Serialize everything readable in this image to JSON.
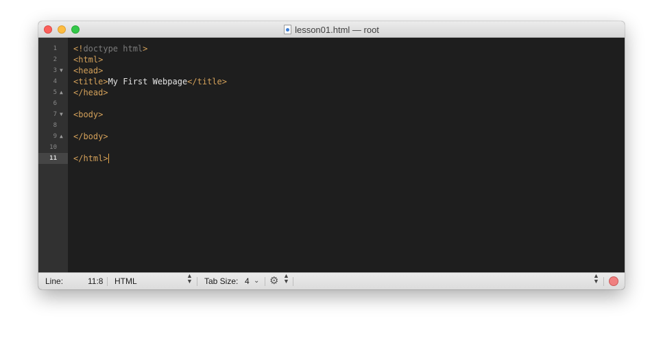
{
  "window": {
    "title": "lesson01.html — root",
    "file_icon": "html-document-icon",
    "traffic_lights": [
      "close",
      "minimize",
      "zoom"
    ]
  },
  "editor": {
    "current_line": 11,
    "lines": [
      {
        "num": "1",
        "fold": "",
        "tokens": [
          {
            "t": "<!",
            "c": "tag"
          },
          {
            "t": "doctype html",
            "c": "doctype"
          },
          {
            "t": ">",
            "c": "tag"
          }
        ]
      },
      {
        "num": "2",
        "fold": "",
        "tokens": [
          {
            "t": "<html>",
            "c": "tag"
          }
        ]
      },
      {
        "num": "3",
        "fold": "▼",
        "tokens": [
          {
            "t": "<head>",
            "c": "tag"
          }
        ]
      },
      {
        "num": "4",
        "fold": "",
        "tokens": [
          {
            "t": "<title>",
            "c": "tag"
          },
          {
            "t": "My First Webpage",
            "c": "text"
          },
          {
            "t": "</title>",
            "c": "tag"
          }
        ]
      },
      {
        "num": "5",
        "fold": "▲",
        "tokens": [
          {
            "t": "</head>",
            "c": "tag"
          }
        ]
      },
      {
        "num": "6",
        "fold": "",
        "tokens": []
      },
      {
        "num": "7",
        "fold": "▼",
        "tokens": [
          {
            "t": "<body>",
            "c": "tag"
          }
        ]
      },
      {
        "num": "8",
        "fold": "",
        "tokens": []
      },
      {
        "num": "9",
        "fold": "▲",
        "tokens": [
          {
            "t": "</body>",
            "c": "tag"
          }
        ]
      },
      {
        "num": "10",
        "fold": "",
        "tokens": []
      },
      {
        "num": "11",
        "fold": "",
        "tokens": [
          {
            "t": "</html>",
            "c": "tag"
          }
        ],
        "caret": true
      }
    ],
    "colors": {
      "tag": "#d4a15a",
      "doctype": "#7b7b7b",
      "text": "#e4e4e4",
      "background": "#1e1e1e",
      "gutter": "#313131"
    }
  },
  "statusbar": {
    "line_label": "Line:",
    "line_value": "11:8",
    "language": "HTML",
    "tab_size_label": "Tab Size:",
    "tab_size_value": "4",
    "settings_icon": "gear-icon",
    "macro_record_icon": "record-icon"
  }
}
